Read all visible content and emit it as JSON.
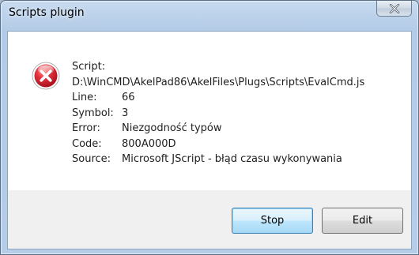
{
  "window": {
    "title": "Scripts plugin"
  },
  "icons": {
    "title_close": "close-icon",
    "message": "error-icon"
  },
  "colors": {
    "error_red": "#d2202f",
    "default_button_border": "#3c7fb1"
  },
  "message": {
    "script_label": "Script:",
    "script_path": "D:\\WinCMD\\AkelPad86\\AkelFiles\\Plugs\\Scripts\\EvalCmd.js",
    "rows": [
      {
        "label": "Line:",
        "value": "66"
      },
      {
        "label": "Symbol:",
        "value": "3"
      },
      {
        "label": "Error:",
        "value": "Niezgodność typów"
      },
      {
        "label": "Code:",
        "value": "800A000D"
      },
      {
        "label": "Source:",
        "value": "Microsoft JScript - błąd czasu wykonywania"
      }
    ]
  },
  "buttons": {
    "stop_label": "Stop",
    "edit_label": "Edit"
  }
}
